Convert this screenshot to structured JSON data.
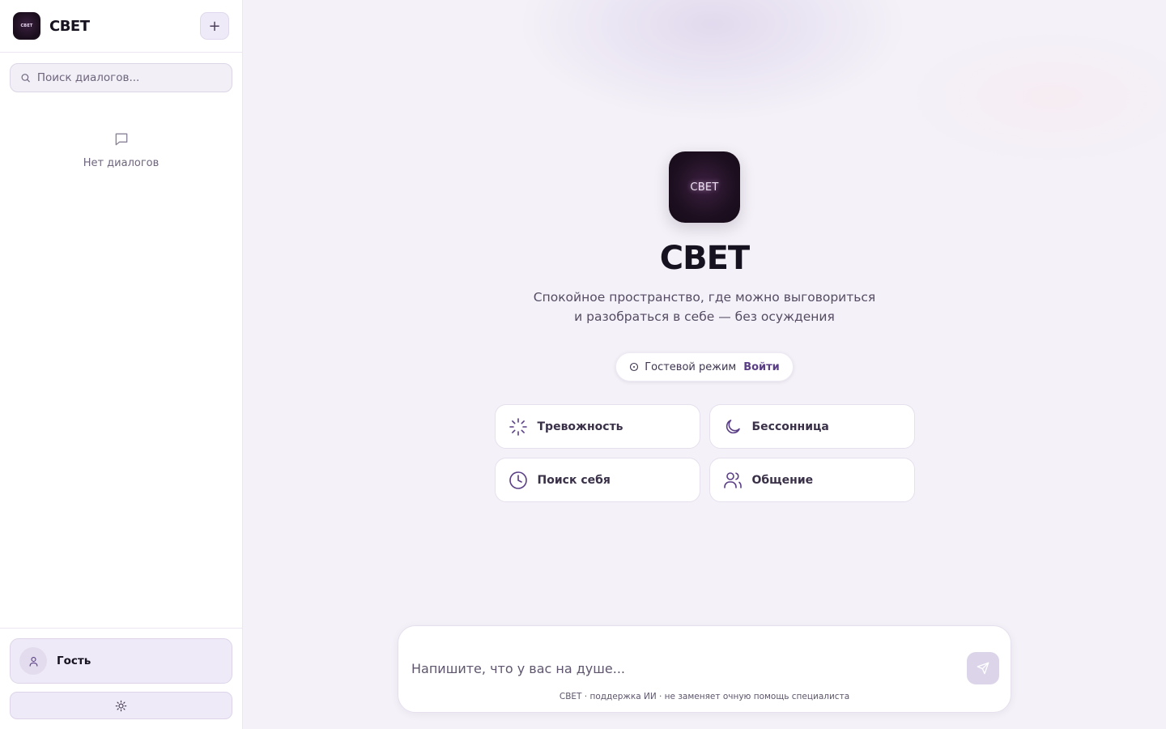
{
  "sidebar": {
    "brand_logo_text": "СВЕТ",
    "brand_name": "СВЕТ",
    "new_chat_label": "+",
    "search_placeholder": "Поиск диалогов...",
    "empty_text": "Нет диалогов",
    "user_name": "Гость"
  },
  "hero": {
    "logo_text": "СВЕТ",
    "title": "СВЕТ",
    "subtitle": "Спокойное пространство, где можно выговориться и разобраться в себе — без осуждения",
    "guest_mode": "Гостевой режим",
    "login": "Войти"
  },
  "topics": [
    {
      "label": "Тревожность",
      "icon": "loader-icon"
    },
    {
      "label": "Бессонница",
      "icon": "moon-icon"
    },
    {
      "label": "Поиск себя",
      "icon": "clock-icon"
    },
    {
      "label": "Общение",
      "icon": "users-icon"
    }
  ],
  "composer": {
    "placeholder": "Напишите, что у вас на душе...",
    "disclaimer": "СВЕТ · поддержка ИИ · не заменяет очную помощь специалиста"
  },
  "colors": {
    "accent": "#5a3e86",
    "background": "#f4f1f8",
    "surface": "#ffffff",
    "logo_bg": "#1d0f20"
  }
}
